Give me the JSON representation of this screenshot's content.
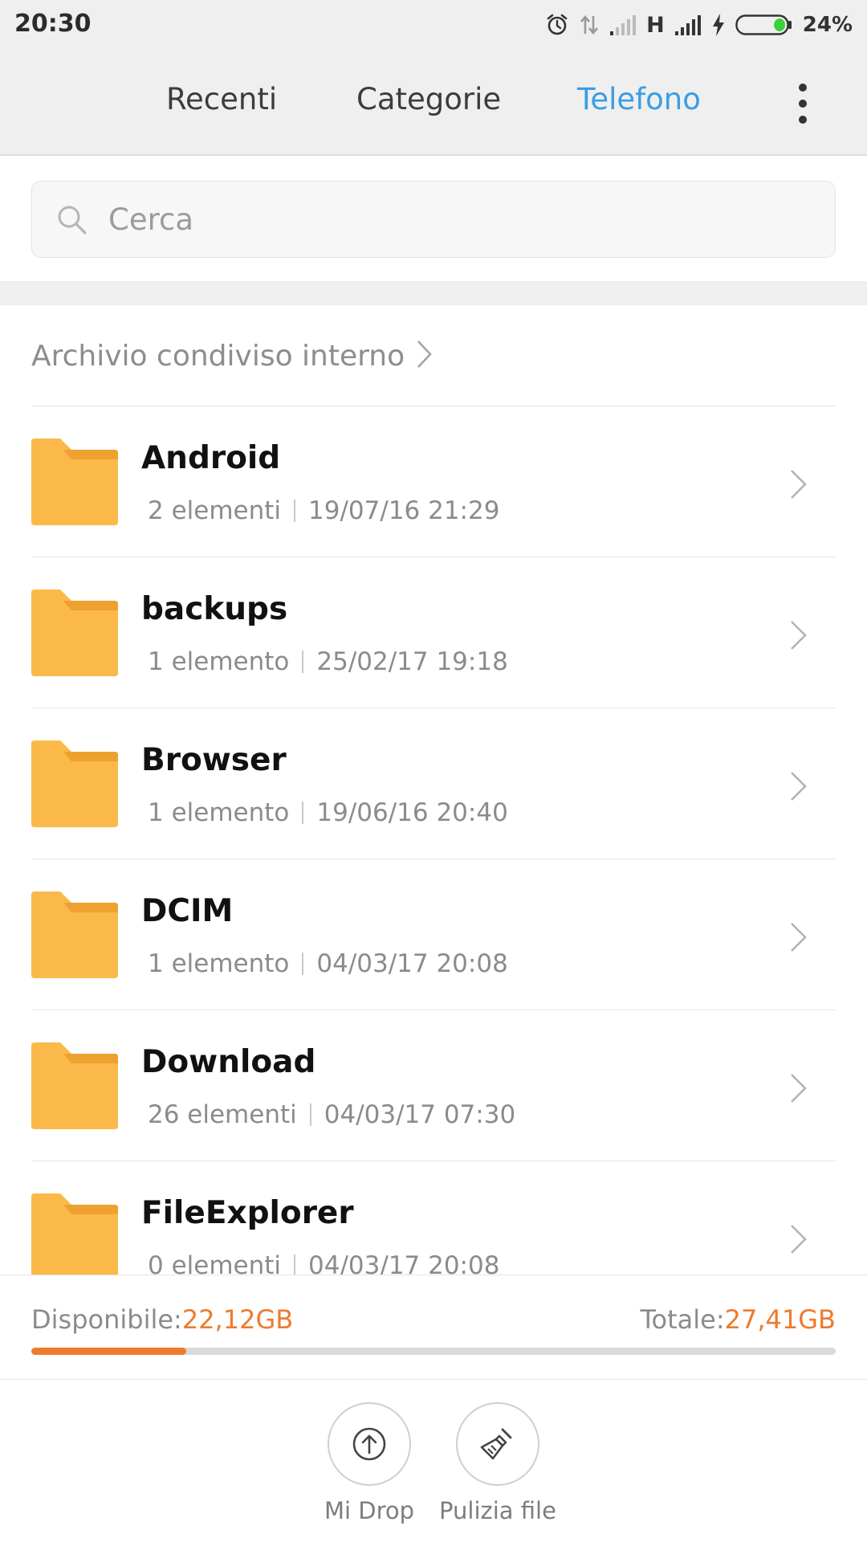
{
  "status_bar": {
    "time": "20:30",
    "network_type": "H",
    "battery_percent": "24%",
    "battery_level": 0.24,
    "icons": [
      "alarm-icon",
      "data-transfer-icon",
      "signal-weak-icon",
      "signal-full-icon",
      "charging-icon",
      "battery-icon"
    ]
  },
  "tabs": [
    {
      "label": "Recenti",
      "active": false
    },
    {
      "label": "Categorie",
      "active": false
    },
    {
      "label": "Telefono",
      "active": true
    }
  ],
  "search": {
    "placeholder": "Cerca"
  },
  "breadcrumb": {
    "label": "Archivio condiviso interno"
  },
  "folders": [
    {
      "name": "Android",
      "count": "2 elementi",
      "date": "19/07/16 21:29"
    },
    {
      "name": "backups",
      "count": "1 elemento",
      "date": "25/02/17 19:18"
    },
    {
      "name": "Browser",
      "count": "1 elemento",
      "date": "19/06/16 20:40"
    },
    {
      "name": "DCIM",
      "count": "1 elemento",
      "date": "04/03/17 20:08"
    },
    {
      "name": "Download",
      "count": "26 elementi",
      "date": "04/03/17 07:30"
    },
    {
      "name": "FileExplorer",
      "count": "0 elementi",
      "date": "04/03/17 20:08"
    }
  ],
  "storage": {
    "available_label": "Disponibile:",
    "available_value": "22,12GB",
    "total_label": "Totale:",
    "total_value": "27,41GB",
    "used_fraction": 0.193
  },
  "actions": [
    {
      "label": "Mi Drop",
      "icon": "upload-circle-icon"
    },
    {
      "label": "Pulizia file",
      "icon": "broom-icon"
    }
  ],
  "colors": {
    "accent_blue": "#3a9de3",
    "accent_orange": "#ee7a2e",
    "folder_yellow": "#fbb94a"
  }
}
